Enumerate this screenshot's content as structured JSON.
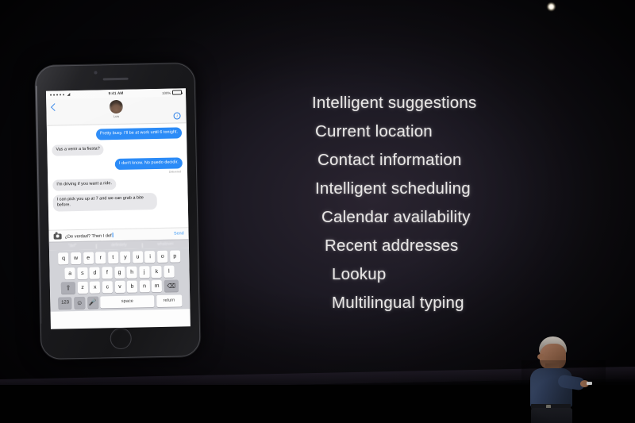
{
  "slide": {
    "features": [
      "Intelligent suggestions",
      "Current location",
      "Contact information",
      "Intelligent scheduling",
      "Calendar availability",
      "Recent addresses",
      "Lookup",
      "Multilingual typing"
    ],
    "text_color": "#e9e7e6",
    "background_color": "#1a1722"
  },
  "phone": {
    "status_bar": {
      "time": "9:41 AM",
      "battery_percent": "100%",
      "carrier_dots": 5,
      "wifi_icon": "wifi-icon"
    },
    "header": {
      "back_icon": "back-chevron-icon",
      "contact_name": "Luis",
      "avatar_icon": "contact-avatar",
      "info_icon": "info-icon"
    },
    "messages": [
      {
        "direction": "outgoing",
        "text": "Pretty busy. I'll be at work until 6 tonight."
      },
      {
        "direction": "incoming",
        "text": "Vas a venir a la fiesta?"
      },
      {
        "direction": "outgoing",
        "text": "I don't know. No puedo decidir."
      },
      {
        "direction": "incoming",
        "text": "I'm driving if you want a ride."
      },
      {
        "direction": "incoming",
        "text": "I can pick you up at 7 and we can grab a bite before."
      }
    ],
    "delivered_label": "Delivered",
    "input_row": {
      "camera_icon": "camera-icon",
      "value": "¿De verdad? Then I def",
      "send_label": "Send"
    },
    "predictive_bar": [
      "\"def\"",
      "definitely",
      "whatever"
    ],
    "keyboard": {
      "row1": [
        "q",
        "w",
        "e",
        "r",
        "t",
        "y",
        "u",
        "i",
        "o",
        "p"
      ],
      "row2": [
        "a",
        "s",
        "d",
        "f",
        "g",
        "h",
        "j",
        "k",
        "l"
      ],
      "row3_shift_icon": "shift-icon",
      "row3": [
        "z",
        "x",
        "c",
        "v",
        "b",
        "n",
        "m"
      ],
      "row3_backspace_icon": "backspace-icon",
      "numbers_label": "123",
      "emoji_icon": "emoji-icon",
      "mic_icon": "microphone-icon",
      "space_label": "space",
      "return_label": "return"
    },
    "accent_blue": "#2b8bf7",
    "incoming_bubble_color": "#e7e7ea"
  },
  "stage": {
    "presenter_label": "presenter",
    "light_spot_label": "stage-light"
  }
}
